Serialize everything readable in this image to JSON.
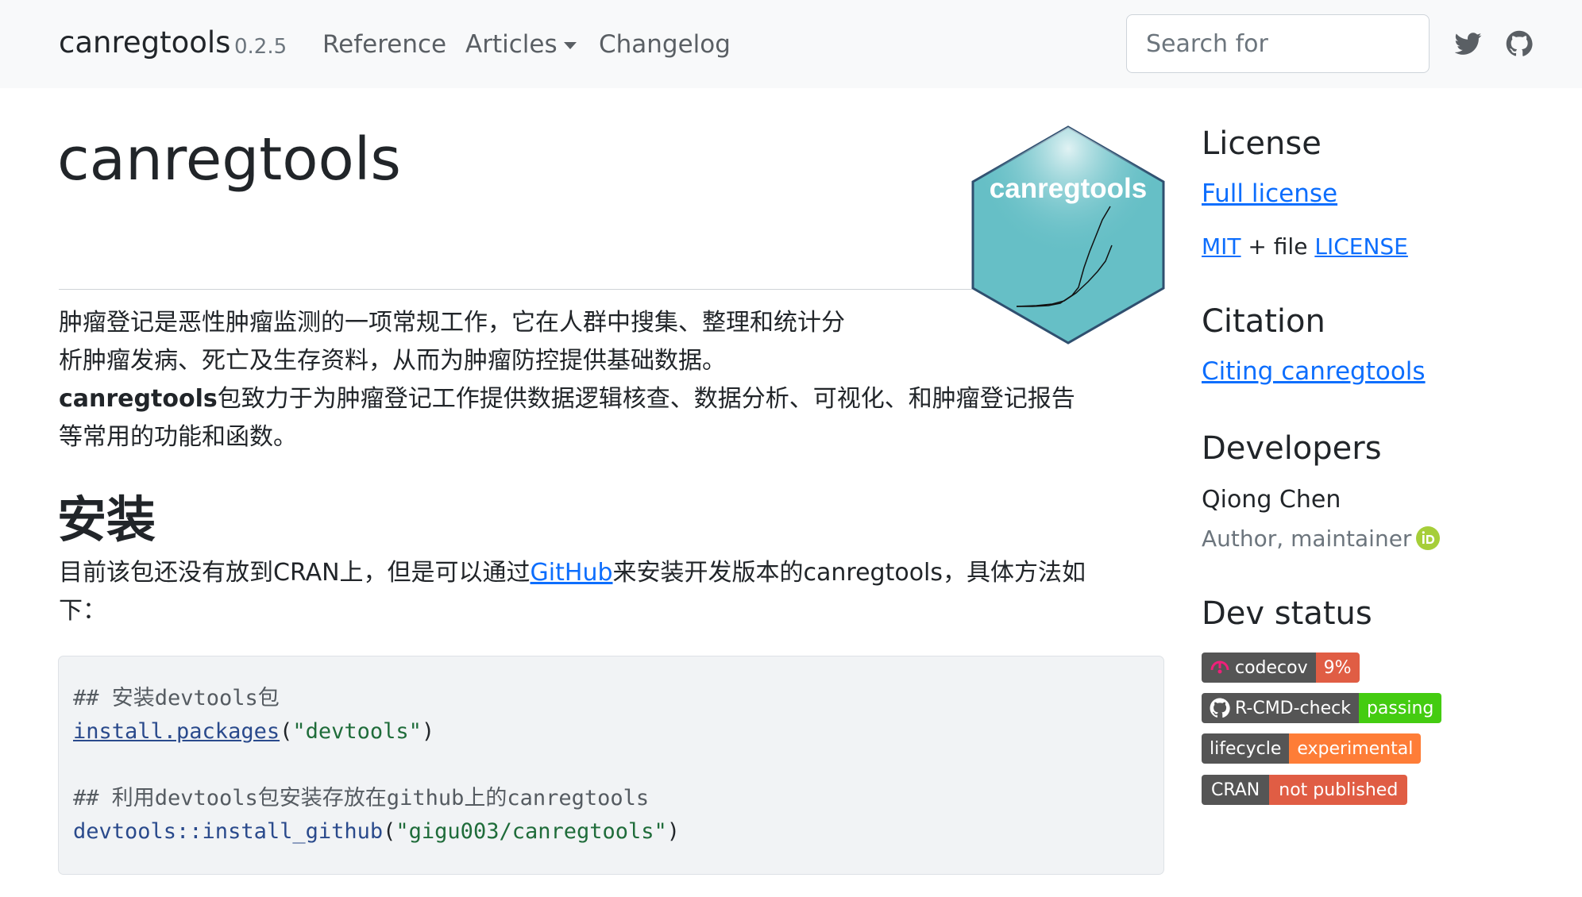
{
  "navbar": {
    "brand": "canregtools",
    "version": "0.2.5",
    "links": [
      {
        "label": "Reference"
      },
      {
        "label": "Articles"
      },
      {
        "label": "Changelog"
      }
    ],
    "search_placeholder": "Search for",
    "icons": [
      "twitter-icon",
      "github-icon"
    ]
  },
  "main": {
    "title": "canregtools",
    "logo_text": "canregtools",
    "intro_line1": "肿瘤登记是恶性肿瘤监测的一项常规工作，它在人群中搜集、整理和统计分",
    "intro_line2": "析肿瘤发病、死亡及生存资料，从而为肿瘤防控提供基础数据。",
    "intro_bold": "canregtools",
    "intro_line3_rest": "包致力于为肿瘤登记工作提供数据逻辑核查、数据分析、可视化、和肿瘤登记报告",
    "intro_line4": "等常用的功能和函数。",
    "install_heading": "安装",
    "install_before": "目前该包还没有放到CRAN上，但是可以通过",
    "install_link": "GitHub",
    "install_after": "来安装开发版本的canregtools，具体方法如",
    "install_line2": "下：",
    "code": {
      "comment1": "## 安装devtools包",
      "fn1": "install.packages",
      "open1": "(",
      "str1": "\"devtools\"",
      "close1": ")",
      "comment2": "## 利用devtools包安装存放在github上的canregtools",
      "fn2": "devtools::install_github",
      "open2": "(",
      "str2": "\"gigu003/canregtools\"",
      "close2": ")"
    }
  },
  "sidebar": {
    "license_heading": "License",
    "full_license": "Full license",
    "mit": "MIT",
    "plus_file": " + file ",
    "license_file": "LICENSE",
    "citation_heading": "Citation",
    "citing_link": "Citing canregtools",
    "developers_heading": "Developers",
    "developer_name": "Qiong Chen",
    "developer_role": "Author, maintainer",
    "devstatus_heading": "Dev status",
    "badges": [
      {
        "left": "codecov",
        "right": "9%",
        "color": "#e05d44",
        "icon": "codecov-icon"
      },
      {
        "left": "R-CMD-check",
        "right": "passing",
        "color": "#4c1",
        "icon": "github-icon"
      },
      {
        "left": "lifecycle",
        "right": "experimental",
        "color": "#fe7d37"
      },
      {
        "left": "CRAN",
        "right": "not published",
        "color": "#e05d44"
      }
    ]
  },
  "colors": {
    "navbar_bg": "#f8f9fa",
    "link": "#0d6efd",
    "logo_fill": "#66bfc6",
    "orcid": "#a6ce39"
  }
}
